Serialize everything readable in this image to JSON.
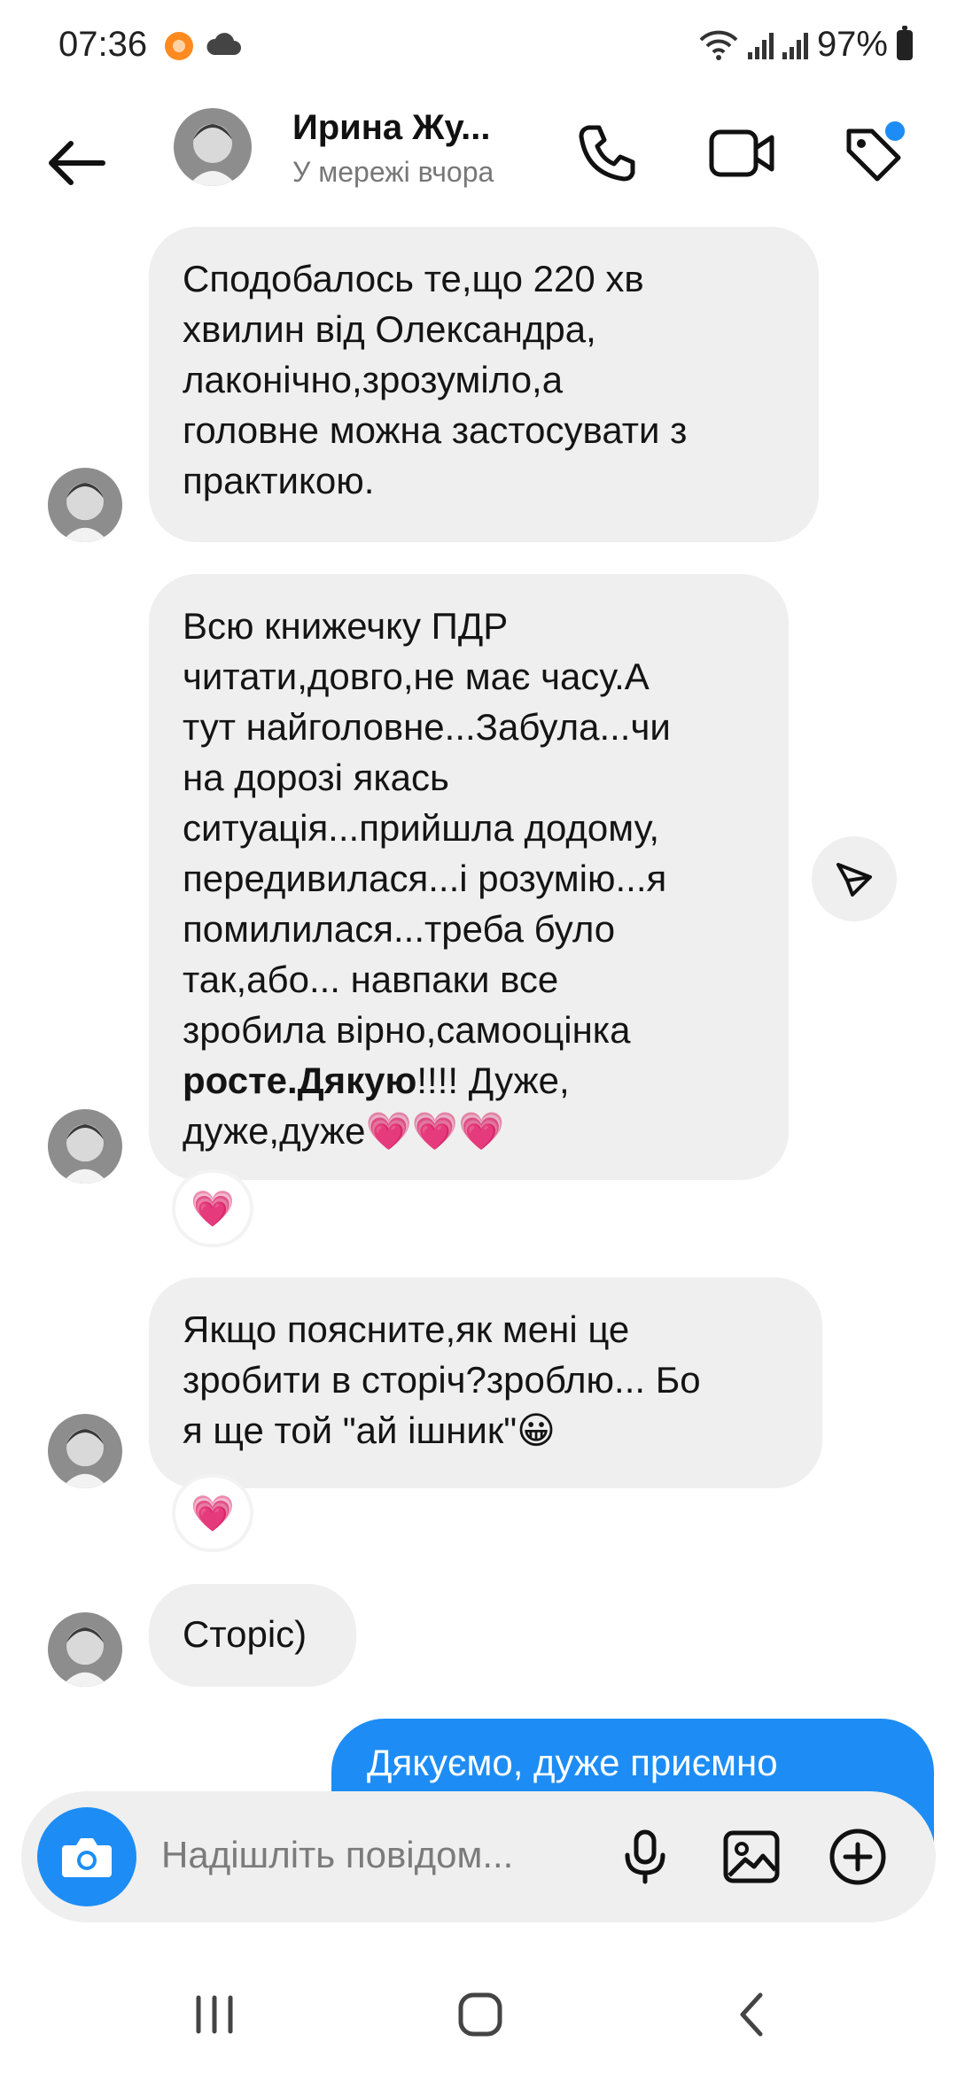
{
  "status_bar": {
    "time": "07:36",
    "battery": "97%"
  },
  "header": {
    "contact_name": "Ирина Жу...",
    "presence": "У мережі вчора"
  },
  "messages": [
    {
      "text": "Сподобалось те,що 220 хв\nхвилин від Олександра,\nлаконічно,зрозуміло,а\nголовне можна застосувати з\nпрактикою."
    },
    {
      "text_before_bold": "Всю книжечку ПДР\nчитати,довго,не має часу.А\nтут найголовне...Забула...чи\nна дорозі якась\nситуація...прийшла додому,\nпередивилася...і розумію...я\nпомилилася...треба було\nтак,або... навпаки все\nзробила вірно,самооцінка\n",
      "bold": "росте.Дякую",
      "text_after_bold": "!!!! Дуже,\nдуже,дуже💗💗💗",
      "reaction": "💗"
    },
    {
      "text": "Якщо поясните,як мені це\nзробити в сторіч?зроблю... Бо\nя ще той \"ай ішник\"😀",
      "reaction": "💗"
    },
    {
      "text": "Сторіс)"
    }
  ],
  "outgoing": {
    "text": "Дякуємо, дуже приємно"
  },
  "composer": {
    "placeholder": "Надішліть повідом..."
  }
}
